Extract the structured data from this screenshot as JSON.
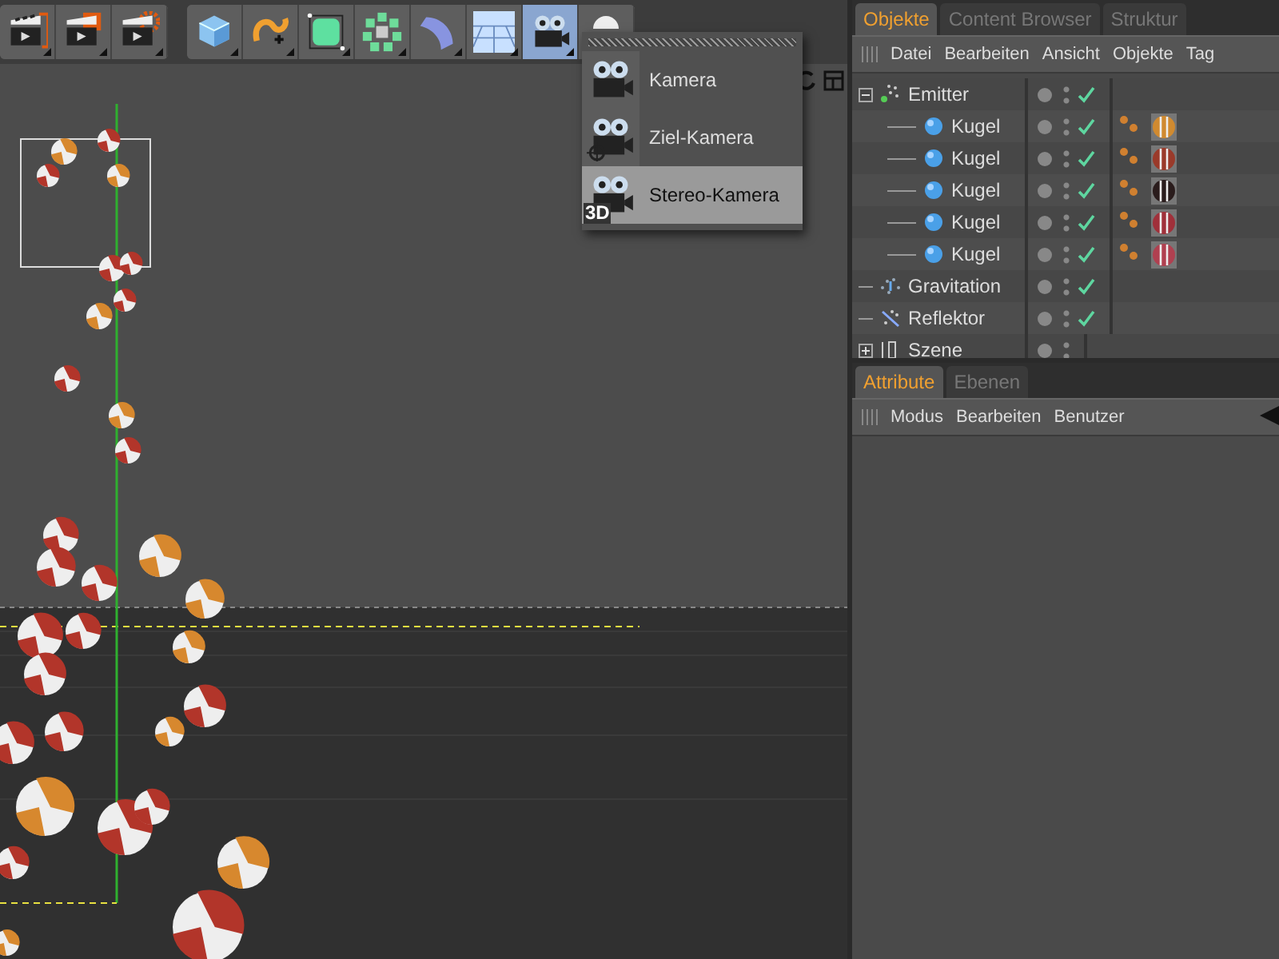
{
  "toolbar": {
    "groups": [
      {
        "items": [
          {
            "kind": "render-view",
            "selected": false
          },
          {
            "kind": "render-picture",
            "selected": false
          },
          {
            "kind": "render-settings",
            "selected": false
          }
        ]
      },
      {
        "items": [
          {
            "kind": "cube",
            "selected": false
          },
          {
            "kind": "spline",
            "selected": false
          },
          {
            "kind": "subdivision",
            "selected": false
          },
          {
            "kind": "array",
            "selected": false
          },
          {
            "kind": "deformer",
            "selected": false
          },
          {
            "kind": "floor",
            "selected": false
          },
          {
            "kind": "camera",
            "selected": true
          },
          {
            "kind": "light",
            "selected": false
          }
        ]
      }
    ]
  },
  "camera_menu": {
    "items": [
      {
        "kind": "camera",
        "label": "Kamera",
        "selected": false
      },
      {
        "kind": "target",
        "label": "Ziel-Kamera",
        "selected": false
      },
      {
        "kind": "stereo",
        "label": "Stereo-Kamera",
        "badge": "3D",
        "selected": true
      }
    ]
  },
  "object_manager": {
    "tabs": [
      {
        "label": "Objekte",
        "selected": true
      },
      {
        "label": "Content Browser",
        "selected": false
      },
      {
        "label": "Struktur",
        "selected": false
      }
    ],
    "menu": [
      "Datei",
      "Bearbeiten",
      "Ansicht",
      "Objekte",
      "Tag"
    ],
    "objects": [
      {
        "kind": "emitter",
        "name": "Emitter",
        "expanded": true,
        "enabled": true,
        "children": [
          {
            "kind": "sphere",
            "name": "Kugel",
            "enabled": true,
            "tags": [
              {
                "kind": "material",
                "color": "#d08a30"
              }
            ]
          },
          {
            "kind": "sphere",
            "name": "Kugel",
            "enabled": true,
            "tags": [
              {
                "kind": "material",
                "color": "#9a3a2a"
              }
            ]
          },
          {
            "kind": "sphere",
            "name": "Kugel",
            "enabled": true,
            "tags": [
              {
                "kind": "material",
                "color": "#2a1c1c"
              }
            ]
          },
          {
            "kind": "sphere",
            "name": "Kugel",
            "enabled": true,
            "tags": [
              {
                "kind": "material",
                "color": "#a0303a"
              }
            ]
          },
          {
            "kind": "sphere",
            "name": "Kugel",
            "enabled": true,
            "tags": [
              {
                "kind": "material",
                "color": "#b04050"
              }
            ]
          }
        ]
      },
      {
        "kind": "gravity",
        "name": "Gravitation",
        "enabled": true
      },
      {
        "kind": "reflector",
        "name": "Reflektor",
        "enabled": true
      },
      {
        "kind": "null",
        "name": "Szene",
        "expanded": false
      }
    ]
  },
  "attribute_manager": {
    "tabs": [
      {
        "label": "Attribute",
        "selected": true
      },
      {
        "label": "Ebenen",
        "selected": false
      }
    ],
    "menu": [
      "Modus",
      "Bearbeiten",
      "Benutzer"
    ]
  }
}
